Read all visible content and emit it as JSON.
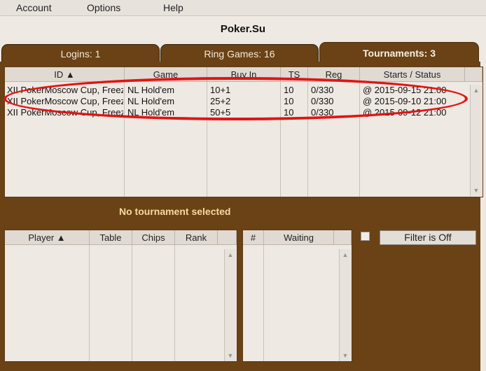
{
  "menu": {
    "account": "Account",
    "options": "Options",
    "help": "Help"
  },
  "app": {
    "title": "Poker.Su"
  },
  "tabs": [
    {
      "label": "Logins: 1"
    },
    {
      "label": "Ring Games: 16"
    },
    {
      "label": "Tournaments: 3"
    }
  ],
  "tournaments": {
    "columns": [
      "ID ▲",
      "Game",
      "Buy In",
      "TS",
      "Reg",
      "Starts / Status"
    ],
    "rows": [
      [
        "XII PokerMoscow Cup, Freez",
        "NL Hold'em",
        "10+1",
        "10",
        "0/330",
        "@ 2015-09-15 21:00"
      ],
      [
        "XII PokerMoscow Cup, Freez",
        "NL Hold'em",
        "25+2",
        "10",
        "0/330",
        "@ 2015-09-10 21:00"
      ],
      [
        "XII PokerMoscow Cup, Freez",
        "NL Hold'em",
        "50+5",
        "10",
        "0/330",
        "@ 2015-09-12 21:00"
      ]
    ]
  },
  "status_text": "No tournament selected",
  "players": {
    "columns": [
      "Player ▲",
      "Table",
      "Chips",
      "Rank"
    ]
  },
  "waiting": {
    "columns": [
      "#",
      "Waiting"
    ]
  },
  "filter": {
    "label": "Filter is Off"
  },
  "colors": {
    "panel": "#6a4216",
    "highlight": "#e11414",
    "status_text": "#f7d9a0"
  }
}
